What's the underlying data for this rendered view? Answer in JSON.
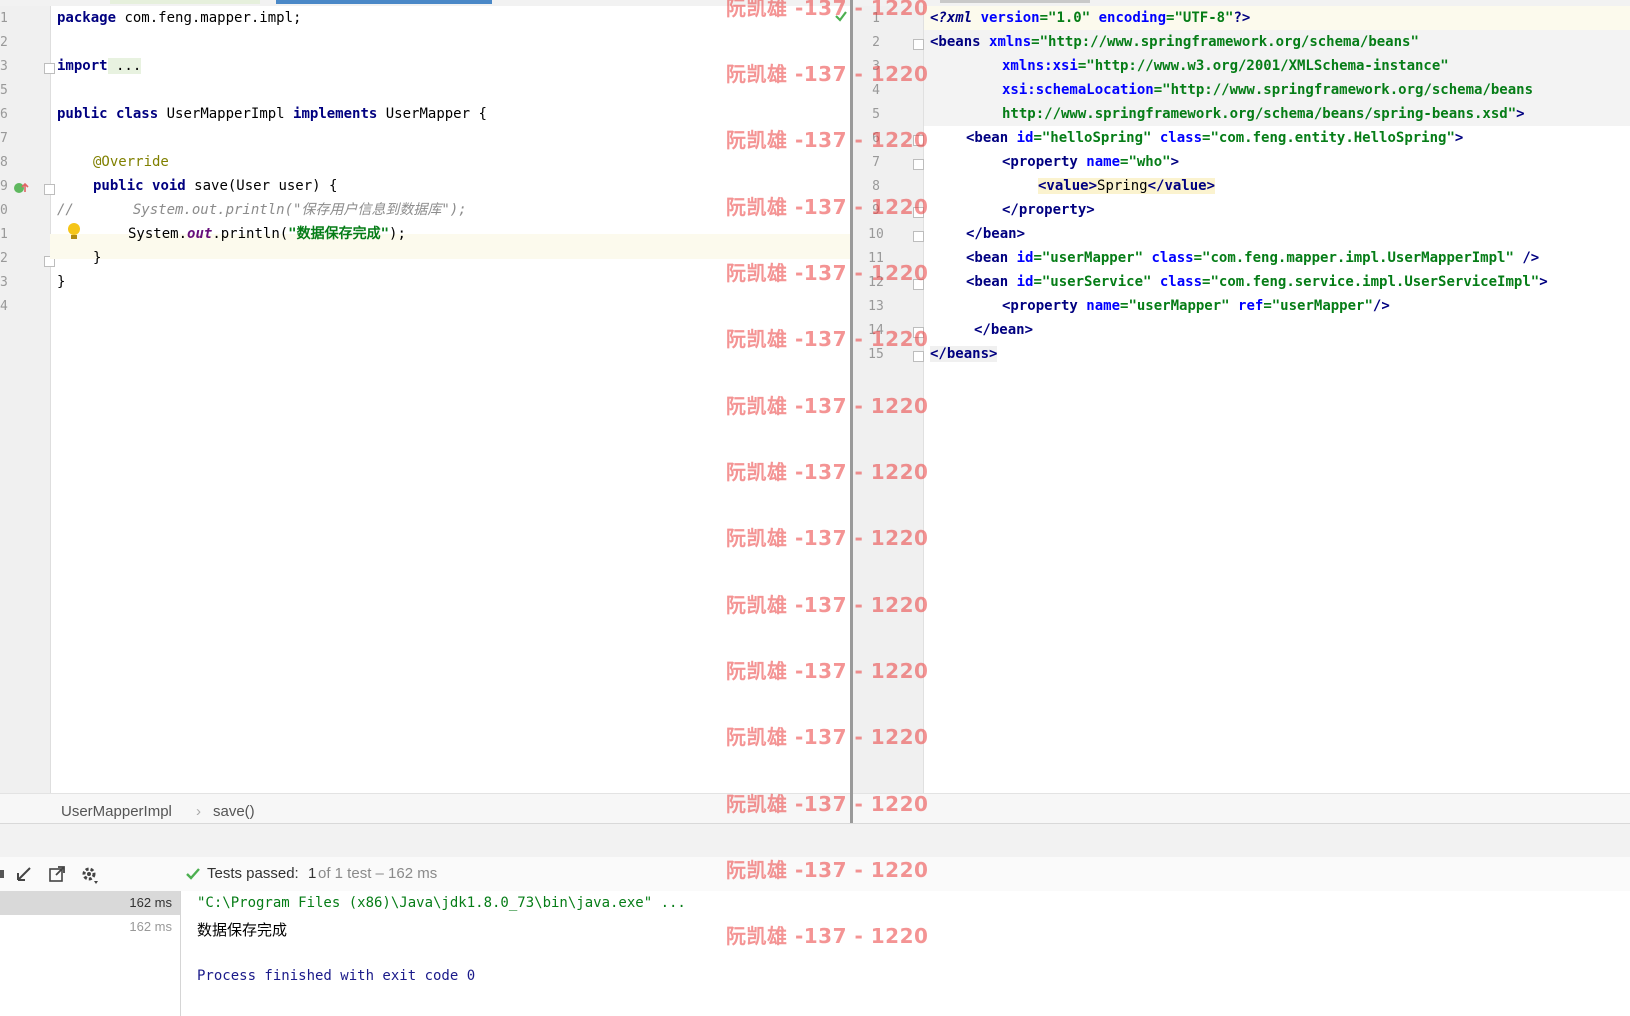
{
  "left_editor": {
    "lines": [
      {
        "num": "1"
      },
      {
        "num": "2"
      },
      {
        "num": "3"
      },
      {
        "num": "5"
      },
      {
        "num": "6"
      },
      {
        "num": "7"
      },
      {
        "num": "8"
      },
      {
        "num": "9"
      },
      {
        "num": "0"
      },
      {
        "num": "1"
      },
      {
        "num": "2"
      },
      {
        "num": "3"
      },
      {
        "num": "4"
      }
    ],
    "code": {
      "l1_kw": "package",
      "l1_rest": " com.feng.mapper.impl;",
      "l3_kw": "import",
      "l3_rest": " ...",
      "l5_kw1": "public",
      "l5_kw2": "class",
      "l5_mid": " UserMapperImpl ",
      "l5_kw3": "implements",
      "l5_rest": " UserMapper {",
      "l7_ann": "@Override",
      "l8_kw1": "public",
      "l8_kw2": "void",
      "l8_rest": " save(User user) {",
      "l9_cmt": "//       System.out.println(\"保存用户信息到数据库\");",
      "l10_a": "System.",
      "l10_fld": "out",
      "l10_b": ".println(",
      "l10_str": "\"数据保存完成\"",
      "l10_c": ");",
      "l11": "}",
      "l12": "}"
    }
  },
  "breadcrumb": {
    "class_name": "UserMapperImpl",
    "separator": "›",
    "method": "save()"
  },
  "right_editor": {
    "line_numbers": [
      "1",
      "2",
      "3",
      "4",
      "5",
      "6",
      "7",
      "8",
      "9",
      "10",
      "11",
      "12",
      "13",
      "14",
      "15"
    ],
    "xml": {
      "l1_pi": "<?xml ",
      "l1_a1": "version",
      "l1_v1": "=\"1.0\" ",
      "l1_a2": "encoding",
      "l1_v2": "=\"UTF-8\"",
      "l1_end": "?>",
      "l2_tag": "<beans ",
      "l2_attr": "xmlns",
      "l2_val": "=\"http://www.springframework.org/schema/beans\"",
      "l3_attr": "xmlns:xsi",
      "l3_val": "=\"http://www.w3.org/2001/XMLSchema-instance\"",
      "l4_attr": "xsi:schemaLocation",
      "l4_val": "=\"http://www.springframework.org/schema/beans",
      "l5_val": "http://www.springframework.org/schema/beans/spring-beans.xsd\"",
      "l5_end": ">",
      "l6_tag": "<bean ",
      "l6_a1": "id",
      "l6_v1": "=\"helloSpring\" ",
      "l6_a2": "class",
      "l6_v2": "=\"com.feng.entity.HelloSpring\"",
      "l6_end": ">",
      "l7_tag": "<property ",
      "l7_a1": "name",
      "l7_v1": "=\"who\"",
      "l7_end": ">",
      "l8_open": "<value>",
      "l8_text": "Spring",
      "l8_close": "</value>",
      "l9": "</property>",
      "l10": "</bean>",
      "l11_tag": "<bean ",
      "l11_a1": "id",
      "l11_v1": "=\"userMapper\" ",
      "l11_a2": "class",
      "l11_v2": "=\"com.feng.mapper.impl.UserMapperImpl\" ",
      "l11_end": "/>",
      "l12_tag": "<bean ",
      "l12_a1": "id",
      "l12_v1": "=\"userService\" ",
      "l12_a2": "class",
      "l12_v2": "=\"com.feng.service.impl.UserServiceImpl\"",
      "l12_end": ">",
      "l13_tag": "<property ",
      "l13_a1": "name",
      "l13_v1": "=\"userMapper\" ",
      "l13_a2": "ref",
      "l13_v2": "=\"userMapper\"",
      "l13_end": "/>",
      "l14": "</bean>",
      "l15": "</beans>"
    }
  },
  "run_panel": {
    "status_prefix": "Tests passed: ",
    "status_count": "1",
    "status_suffix": " of 1 test – 162 ms",
    "tree_times": [
      "162 ms",
      "162 ms"
    ],
    "console": {
      "command": "\"C:\\Program Files (x86)\\Java\\jdk1.8.0_73\\bin\\java.exe\" ...",
      "output": "数据保存完成",
      "exit": "Process finished with exit code 0"
    },
    "icons": [
      "scroll-up-icon",
      "export-icon",
      "import-icon",
      "gear-icon",
      "check-icon"
    ]
  },
  "watermark": {
    "text": "阮凯雄 -137 - 1220"
  },
  "colors": {
    "keyword": "#000080",
    "string": "#067d17",
    "annotation": "#808000",
    "comment": "#8c8c8c",
    "watermark": "#eb3c3c",
    "active_tab": "#4a88c7"
  }
}
